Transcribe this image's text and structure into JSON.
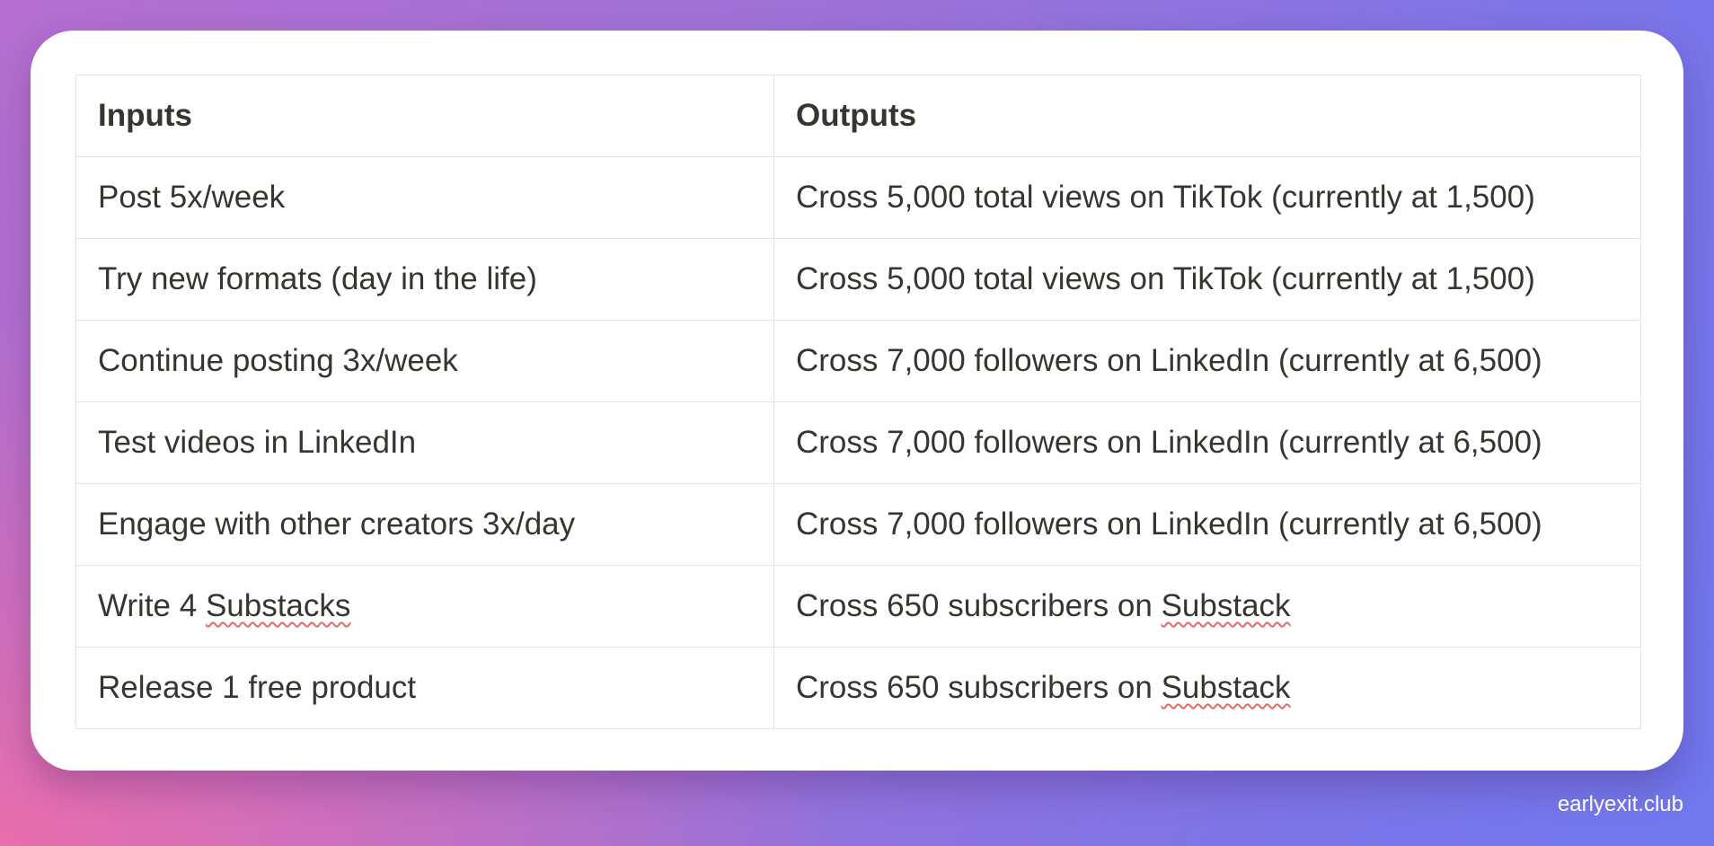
{
  "table": {
    "headers": [
      "Inputs",
      "Outputs"
    ],
    "rows": [
      {
        "input": "Post 5x/week",
        "output": "Cross 5,000 total views on TikTok (currently at 1,500)"
      },
      {
        "input": "Try new formats (day in the life)",
        "output": "Cross 5,000 total views on TikTok (currently at 1,500)"
      },
      {
        "input": "Continue posting 3x/week",
        "output": "Cross 7,000 followers on LinkedIn (currently at 6,500)"
      },
      {
        "input": "Test videos in LinkedIn",
        "output": "Cross 7,000 followers on LinkedIn (currently at 6,500)"
      },
      {
        "input": "Engage with other creators 3x/day",
        "output": "Cross 7,000 followers on LinkedIn (currently at 6,500)"
      },
      {
        "input_prefix": "Write 4 ",
        "input_flagged": "Substacks",
        "output_prefix": "Cross 650 subscribers on ",
        "output_flagged": "Substack"
      },
      {
        "input": "Release 1 free product",
        "output_prefix": "Cross 650 subscribers on ",
        "output_flagged": "Substack"
      }
    ]
  },
  "watermark": "earlyexit.club"
}
